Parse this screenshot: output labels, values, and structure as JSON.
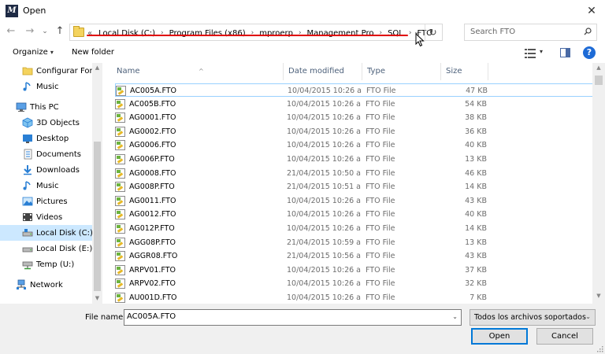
{
  "window": {
    "title": "Open",
    "app_icon_text": "M",
    "close_glyph": "✕"
  },
  "nav": {
    "back_glyph": "←",
    "forward_glyph": "→",
    "recent_glyph": "⌄",
    "up_glyph": "↑"
  },
  "address": {
    "more_glyph": "«",
    "crumbs": [
      "Local Disk (C:)",
      "Program Files (x86)",
      "mproerp",
      "Management Pro",
      "SQL",
      "FTO"
    ],
    "sep_glyph": "›",
    "dropdown_glyph": "⌄",
    "refresh_glyph": "↻"
  },
  "search": {
    "placeholder": "Search FTO"
  },
  "toolbar": {
    "organize_label": "Organize",
    "organize_caret": "▾",
    "new_folder_label": "New folder",
    "view_caret": "▾",
    "help_glyph": "?"
  },
  "sidebar": {
    "items": [
      {
        "label": "Configurar Fond",
        "icon": "folder-icon"
      },
      {
        "label": "Music",
        "icon": "music-icon"
      },
      {
        "label": "This PC",
        "icon": "computer-icon"
      },
      {
        "label": "3D Objects",
        "icon": "3d-objects-icon"
      },
      {
        "label": "Desktop",
        "icon": "desktop-icon"
      },
      {
        "label": "Documents",
        "icon": "documents-icon"
      },
      {
        "label": "Downloads",
        "icon": "downloads-icon"
      },
      {
        "label": "Music",
        "icon": "music-icon"
      },
      {
        "label": "Pictures",
        "icon": "pictures-icon"
      },
      {
        "label": "Videos",
        "icon": "videos-icon"
      },
      {
        "label": "Local Disk (C:)",
        "icon": "drive-icon",
        "selected": true
      },
      {
        "label": "Local Disk (E:)",
        "icon": "drive-icon"
      },
      {
        "label": "Temp (U:)",
        "icon": "network-drive-icon"
      },
      {
        "label": "Network",
        "icon": "network-icon"
      }
    ]
  },
  "filelist": {
    "columns": {
      "name": "Name",
      "date": "Date modified",
      "type": "Type",
      "size": "Size"
    },
    "sort_glyph": "^",
    "files": [
      {
        "name": "AC005A.FTO",
        "date": "10/04/2015 10:26 a",
        "type": "FTO File",
        "size": "47 KB",
        "selected": true
      },
      {
        "name": "AC005B.FTO",
        "date": "10/04/2015 10:26 a",
        "type": "FTO File",
        "size": "54 KB"
      },
      {
        "name": "AG0001.FTO",
        "date": "10/04/2015 10:26 a",
        "type": "FTO File",
        "size": "38 KB"
      },
      {
        "name": "AG0002.FTO",
        "date": "10/04/2015 10:26 a",
        "type": "FTO File",
        "size": "36 KB"
      },
      {
        "name": "AG0006.FTO",
        "date": "10/04/2015 10:26 a",
        "type": "FTO File",
        "size": "40 KB"
      },
      {
        "name": "AG006P.FTO",
        "date": "10/04/2015 10:26 a",
        "type": "FTO File",
        "size": "13 KB"
      },
      {
        "name": "AG0008.FTO",
        "date": "21/04/2015 10:50 a",
        "type": "FTO File",
        "size": "46 KB"
      },
      {
        "name": "AG008P.FTO",
        "date": "21/04/2015 10:51 a",
        "type": "FTO File",
        "size": "14 KB"
      },
      {
        "name": "AG0011.FTO",
        "date": "10/04/2015 10:26 a",
        "type": "FTO File",
        "size": "43 KB"
      },
      {
        "name": "AG0012.FTO",
        "date": "10/04/2015 10:26 a",
        "type": "FTO File",
        "size": "40 KB"
      },
      {
        "name": "AG012P.FTO",
        "date": "10/04/2015 10:26 a",
        "type": "FTO File",
        "size": "14 KB"
      },
      {
        "name": "AGG08P.FTO",
        "date": "21/04/2015 10:59 a",
        "type": "FTO File",
        "size": "13 KB"
      },
      {
        "name": "AGGR08.FTO",
        "date": "21/04/2015 10:56 a",
        "type": "FTO File",
        "size": "43 KB"
      },
      {
        "name": "ARPV01.FTO",
        "date": "10/04/2015 10:26 a",
        "type": "FTO File",
        "size": "37 KB"
      },
      {
        "name": "ARPV02.FTO",
        "date": "10/04/2015 10:26 a",
        "type": "FTO File",
        "size": "32 KB"
      },
      {
        "name": "AU001D.FTO",
        "date": "10/04/2015 10:26 a",
        "type": "FTO File",
        "size": "7 KB"
      }
    ]
  },
  "bottom": {
    "file_name_label": "File name:",
    "file_name_value": "AC005A.FTO",
    "file_type_value": "Todos los archivos soportados",
    "dropdown_glyph": "⌄",
    "open_label": "Open",
    "cancel_label": "Cancel"
  },
  "colors": {
    "accent": "#0078d7",
    "selection": "#cce8ff",
    "underline_annotation": "#e00000"
  }
}
